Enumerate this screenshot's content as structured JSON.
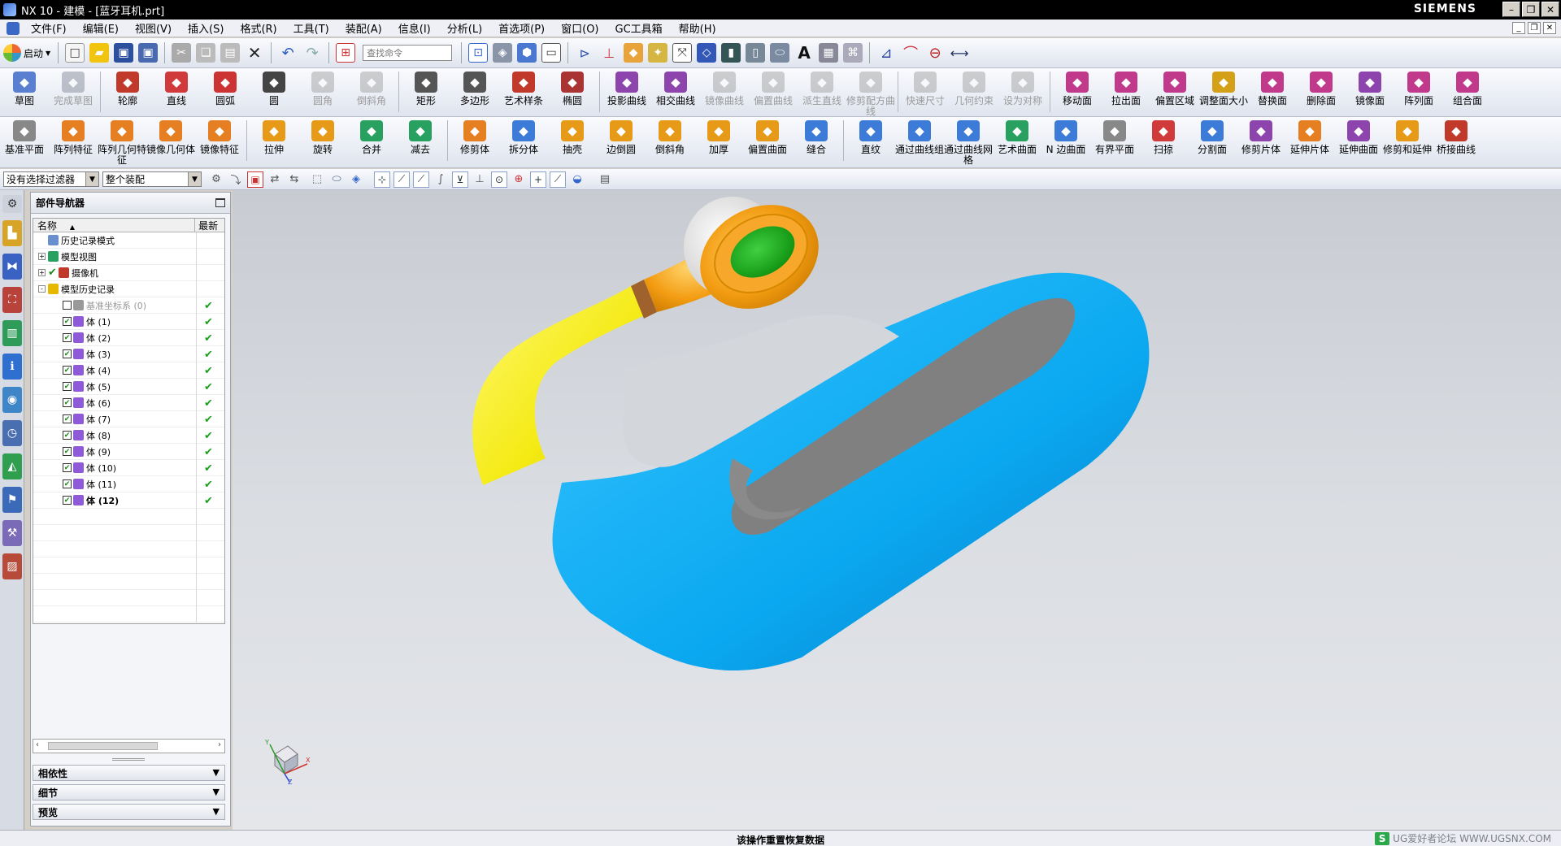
{
  "window": {
    "title": "NX 10 - 建模 - [蓝牙耳机.prt]",
    "brand": "SIEMENS"
  },
  "menu": [
    "文件(F)",
    "编辑(E)",
    "视图(V)",
    "插入(S)",
    "格式(R)",
    "工具(T)",
    "装配(A)",
    "信息(I)",
    "分析(L)",
    "首选项(P)",
    "窗口(O)",
    "GC工具箱",
    "帮助(H)"
  ],
  "standard_toolbar": {
    "start_label": "启动",
    "search_placeholder": "查找命令"
  },
  "sketch_toolbar": [
    {
      "label": "草图",
      "icon": "sketch-icon",
      "color": "#5b7fd0",
      "dim": false
    },
    {
      "label": "完成草图",
      "icon": "finish-sketch-icon",
      "color": "#7a8090",
      "dim": true
    },
    {
      "label": "轮廓",
      "icon": "profile-icon",
      "color": "#c0392b",
      "dim": false
    },
    {
      "label": "直线",
      "icon": "line-icon",
      "color": "#d03a3a",
      "dim": false
    },
    {
      "label": "圆弧",
      "icon": "arc-icon",
      "color": "#c33",
      "dim": false
    },
    {
      "label": "圆",
      "icon": "circle-icon",
      "color": "#444",
      "dim": false
    },
    {
      "label": "圆角",
      "icon": "fillet-icon",
      "color": "#999",
      "dim": true
    },
    {
      "label": "倒斜角",
      "icon": "chamfer-icon",
      "color": "#999",
      "dim": true
    },
    {
      "label": "矩形",
      "icon": "rectangle-icon",
      "color": "#555",
      "dim": false
    },
    {
      "label": "多边形",
      "icon": "polygon-icon",
      "color": "#555",
      "dim": false
    },
    {
      "label": "艺术样条",
      "icon": "spline-icon",
      "color": "#c0392b",
      "dim": false
    },
    {
      "label": "椭圆",
      "icon": "ellipse-icon",
      "color": "#a33",
      "dim": false
    },
    {
      "label": "投影曲线",
      "icon": "project-curve-icon",
      "color": "#8e44ad",
      "dim": false
    },
    {
      "label": "相交曲线",
      "icon": "intersect-curve-icon",
      "color": "#8e44ad",
      "dim": false
    },
    {
      "label": "镜像曲线",
      "icon": "mirror-curve-icon",
      "color": "#999",
      "dim": true
    },
    {
      "label": "偏置曲线",
      "icon": "offset-curve-icon",
      "color": "#999",
      "dim": true
    },
    {
      "label": "派生直线",
      "icon": "derived-line-icon",
      "color": "#999",
      "dim": true
    },
    {
      "label": "修剪配方曲线",
      "icon": "trim-curve-icon",
      "color": "#999",
      "dim": true
    },
    {
      "label": "快速尺寸",
      "icon": "rapid-dimension-icon",
      "color": "#999",
      "dim": true
    },
    {
      "label": "几何约束",
      "icon": "geometric-constraint-icon",
      "color": "#999",
      "dim": true
    },
    {
      "label": "设为对称",
      "icon": "symmetric-icon",
      "color": "#999",
      "dim": true
    },
    {
      "label": "移动面",
      "icon": "move-face-icon",
      "color": "#c0398b",
      "dim": false
    },
    {
      "label": "拉出面",
      "icon": "pull-face-icon",
      "color": "#c0398b",
      "dim": false
    },
    {
      "label": "偏置区域",
      "icon": "offset-region-icon",
      "color": "#c0398b",
      "dim": false
    },
    {
      "label": "调整面大小",
      "icon": "resize-face-icon",
      "color": "#d4a017",
      "dim": false
    },
    {
      "label": "替换面",
      "icon": "replace-face-icon",
      "color": "#c0398b",
      "dim": false
    },
    {
      "label": "删除面",
      "icon": "delete-face-icon",
      "color": "#c0398b",
      "dim": false
    },
    {
      "label": "镜像面",
      "icon": "mirror-face-icon",
      "color": "#8e44ad",
      "dim": false
    },
    {
      "label": "阵列面",
      "icon": "pattern-face-icon",
      "color": "#c0398b",
      "dim": false
    },
    {
      "label": "组合面",
      "icon": "group-face-icon",
      "color": "#c0398b",
      "dim": false
    }
  ],
  "feature_toolbar": [
    {
      "label": "基准平面",
      "icon": "datum-plane-icon",
      "color": "#888",
      "dim": false
    },
    {
      "label": "阵列特征",
      "icon": "pattern-feature-icon",
      "color": "#e67e22",
      "dim": false
    },
    {
      "label": "阵列几何特征",
      "icon": "pattern-geometry-icon",
      "color": "#e67e22",
      "dim": false
    },
    {
      "label": "镜像几何体",
      "icon": "mirror-geometry-icon",
      "color": "#e67e22",
      "dim": false
    },
    {
      "label": "镜像特征",
      "icon": "mirror-feature-icon",
      "color": "#e67e22",
      "dim": false
    },
    {
      "label": "拉伸",
      "icon": "extrude-icon",
      "color": "#e69a17",
      "dim": false
    },
    {
      "label": "旋转",
      "icon": "revolve-icon",
      "color": "#e69a17",
      "dim": false
    },
    {
      "label": "合并",
      "icon": "unite-icon",
      "color": "#27a060",
      "dim": false
    },
    {
      "label": "减去",
      "icon": "subtract-icon",
      "color": "#27a060",
      "dim": false
    },
    {
      "label": "修剪体",
      "icon": "trim-body-icon",
      "color": "#e67e22",
      "dim": false
    },
    {
      "label": "拆分体",
      "icon": "split-body-icon",
      "color": "#3d7bd8",
      "dim": false
    },
    {
      "label": "抽壳",
      "icon": "shell-icon",
      "color": "#e69a17",
      "dim": false
    },
    {
      "label": "边倒圆",
      "icon": "edge-blend-icon",
      "color": "#e69a17",
      "dim": false
    },
    {
      "label": "倒斜角",
      "icon": "chamfer-feature-icon",
      "color": "#e69a17",
      "dim": false
    },
    {
      "label": "加厚",
      "icon": "thicken-icon",
      "color": "#e69a17",
      "dim": false
    },
    {
      "label": "偏置曲面",
      "icon": "offset-surface-icon",
      "color": "#e69a17",
      "dim": false
    },
    {
      "label": "缝合",
      "icon": "sew-icon",
      "color": "#3d7bd8",
      "dim": false
    },
    {
      "label": "直纹",
      "icon": "ruled-icon",
      "color": "#3d7bd8",
      "dim": false
    },
    {
      "label": "通过曲线组",
      "icon": "through-curves-icon",
      "color": "#3d7bd8",
      "dim": false
    },
    {
      "label": "通过曲线网格",
      "icon": "curve-mesh-icon",
      "color": "#3d7bd8",
      "dim": false
    },
    {
      "label": "艺术曲面",
      "icon": "studio-surface-icon",
      "color": "#27a060",
      "dim": false
    },
    {
      "label": "N 边曲面",
      "icon": "n-sided-surface-icon",
      "color": "#3d7bd8",
      "dim": false
    },
    {
      "label": "有界平面",
      "icon": "bounded-plane-icon",
      "color": "#888",
      "dim": false
    },
    {
      "label": "扫掠",
      "icon": "swept-icon",
      "color": "#d03a3a",
      "dim": false
    },
    {
      "label": "分割面",
      "icon": "divide-face-icon",
      "color": "#3d7bd8",
      "dim": false
    },
    {
      "label": "修剪片体",
      "icon": "trim-sheet-icon",
      "color": "#8e44ad",
      "dim": false
    },
    {
      "label": "延伸片体",
      "icon": "extend-sheet-icon",
      "color": "#e67e22",
      "dim": false
    },
    {
      "label": "延伸曲面",
      "icon": "extend-surface-icon",
      "color": "#8e44ad",
      "dim": false
    },
    {
      "label": "修剪和延伸",
      "icon": "trim-extend-icon",
      "color": "#e69a17",
      "dim": false
    },
    {
      "label": "桥接曲线",
      "icon": "bridge-curve-icon",
      "color": "#c0392b",
      "dim": false
    }
  ],
  "selection_bar": {
    "filter": "没有选择过滤器",
    "scope": "整个装配"
  },
  "navigator": {
    "title": "部件导航器",
    "col_name": "名称",
    "col_new": "最新",
    "nodes": [
      {
        "label": "历史记录模式",
        "level": 1,
        "expand": "",
        "check": false,
        "icon_color": "#6a8fcf",
        "ok": false,
        "dim": false,
        "bold": false
      },
      {
        "label": "模型视图",
        "level": 1,
        "expand": "+",
        "check": false,
        "icon_color": "#27a060",
        "ok": false,
        "dim": false,
        "bold": false
      },
      {
        "label": "摄像机",
        "level": 1,
        "expand": "+",
        "check": true,
        "icon_color": "#c0392b",
        "ok": false,
        "dim": false,
        "bold": false
      },
      {
        "label": "模型历史记录",
        "level": 1,
        "expand": "-",
        "check": false,
        "icon_color": "#e6b800",
        "ok": false,
        "dim": false,
        "bold": false
      },
      {
        "label": "基准坐标系 (0)",
        "level": 2,
        "expand": "",
        "check": false,
        "icon_color": "#999999",
        "ok": true,
        "dim": true,
        "bold": false
      },
      {
        "label": "体 (1)",
        "level": 2,
        "expand": "",
        "check": true,
        "icon_color": "#8e5ad8",
        "ok": true,
        "dim": false,
        "bold": false
      },
      {
        "label": "体 (2)",
        "level": 2,
        "expand": "",
        "check": true,
        "icon_color": "#8e5ad8",
        "ok": true,
        "dim": false,
        "bold": false
      },
      {
        "label": "体 (3)",
        "level": 2,
        "expand": "",
        "check": true,
        "icon_color": "#8e5ad8",
        "ok": true,
        "dim": false,
        "bold": false
      },
      {
        "label": "体 (4)",
        "level": 2,
        "expand": "",
        "check": true,
        "icon_color": "#8e5ad8",
        "ok": true,
        "dim": false,
        "bold": false
      },
      {
        "label": "体 (5)",
        "level": 2,
        "expand": "",
        "check": true,
        "icon_color": "#8e5ad8",
        "ok": true,
        "dim": false,
        "bold": false
      },
      {
        "label": "体 (6)",
        "level": 2,
        "expand": "",
        "check": true,
        "icon_color": "#8e5ad8",
        "ok": true,
        "dim": false,
        "bold": false
      },
      {
        "label": "体 (7)",
        "level": 2,
        "expand": "",
        "check": true,
        "icon_color": "#8e5ad8",
        "ok": true,
        "dim": false,
        "bold": false
      },
      {
        "label": "体 (8)",
        "level": 2,
        "expand": "",
        "check": true,
        "icon_color": "#8e5ad8",
        "ok": true,
        "dim": false,
        "bold": false
      },
      {
        "label": "体 (9)",
        "level": 2,
        "expand": "",
        "check": true,
        "icon_color": "#8e5ad8",
        "ok": true,
        "dim": false,
        "bold": false
      },
      {
        "label": "体 (10)",
        "level": 2,
        "expand": "",
        "check": true,
        "icon_color": "#8e5ad8",
        "ok": true,
        "dim": false,
        "bold": false
      },
      {
        "label": "体 (11)",
        "level": 2,
        "expand": "",
        "check": true,
        "icon_color": "#8e5ad8",
        "ok": true,
        "dim": false,
        "bold": false
      },
      {
        "label": "体 (12)",
        "level": 2,
        "expand": "",
        "check": true,
        "icon_color": "#8e5ad8",
        "ok": true,
        "dim": false,
        "bold": true
      }
    ]
  },
  "panes": {
    "dependencies": "相依性",
    "details": "细节",
    "preview": "预览"
  },
  "status": {
    "message": "该操作重置恢复数据",
    "watermark": "UG爱好者论坛 WWW.UGSNX.COM",
    "watermark_badge": "S"
  },
  "colors": {
    "model_blue": "#0aa8f0",
    "model_yellow": "#f4ea12",
    "model_orange": "#f39c12",
    "model_green": "#12a012",
    "model_gray": "#808080",
    "model_white": "#f2f2f2"
  }
}
